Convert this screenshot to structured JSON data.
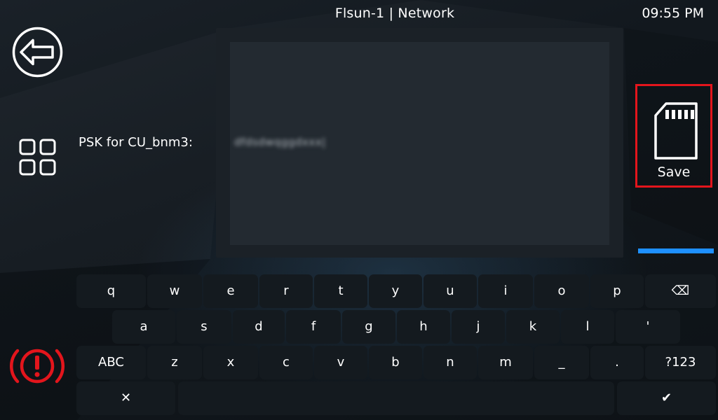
{
  "header": {
    "title": "Flsun-1 | Network",
    "clock": "09:55 PM"
  },
  "prompt": {
    "label": "PSK for CU_bnm3:",
    "value": "dfdsdwqggdxxx|"
  },
  "save": {
    "label": "Save"
  },
  "keyboard": {
    "row1": [
      "q",
      "w",
      "e",
      "r",
      "t",
      "y",
      "u",
      "i",
      "o",
      "p",
      "⌫"
    ],
    "row2": [
      "a",
      "s",
      "d",
      "f",
      "g",
      "h",
      "j",
      "k",
      "l",
      "'"
    ],
    "row3": [
      "ABC",
      "z",
      "x",
      "c",
      "v",
      "b",
      "n",
      "m",
      "_",
      ".",
      "?123"
    ],
    "row4": [
      "✕",
      "",
      "✔"
    ]
  },
  "colors": {
    "accent_blue": "#1e90ff",
    "highlight_red": "#e3151c",
    "estop_red": "#e3151c",
    "key_bg": "#141a1f"
  },
  "icons": {
    "back": "back-arrow-circle-icon",
    "menu": "grid-menu-icon",
    "estop": "emergency-stop-icon",
    "save": "sd-card-icon"
  }
}
